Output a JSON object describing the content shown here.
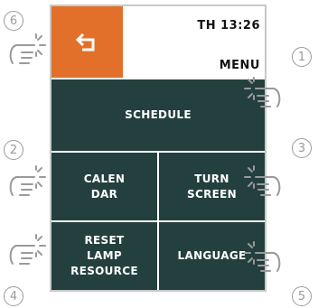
{
  "header": {
    "time": "TH  13:26",
    "menu": "MENU"
  },
  "tiles": {
    "schedule": "SCHEDULE",
    "calendar": "CALEN\nDAR",
    "turn_screen": "TURN\nSCREEN",
    "reset_lamp": "RESET\nLAMP\nRESOURCE",
    "language": "LANGUAGE"
  },
  "markers": [
    "1",
    "2",
    "3",
    "4",
    "5",
    "6"
  ],
  "icons": {
    "back": "back-arrow-icon",
    "touch": "tap-gesture-icon"
  },
  "colors": {
    "accent": "#e2702a",
    "tile": "#23403e",
    "marker": "#9a9a9a"
  }
}
